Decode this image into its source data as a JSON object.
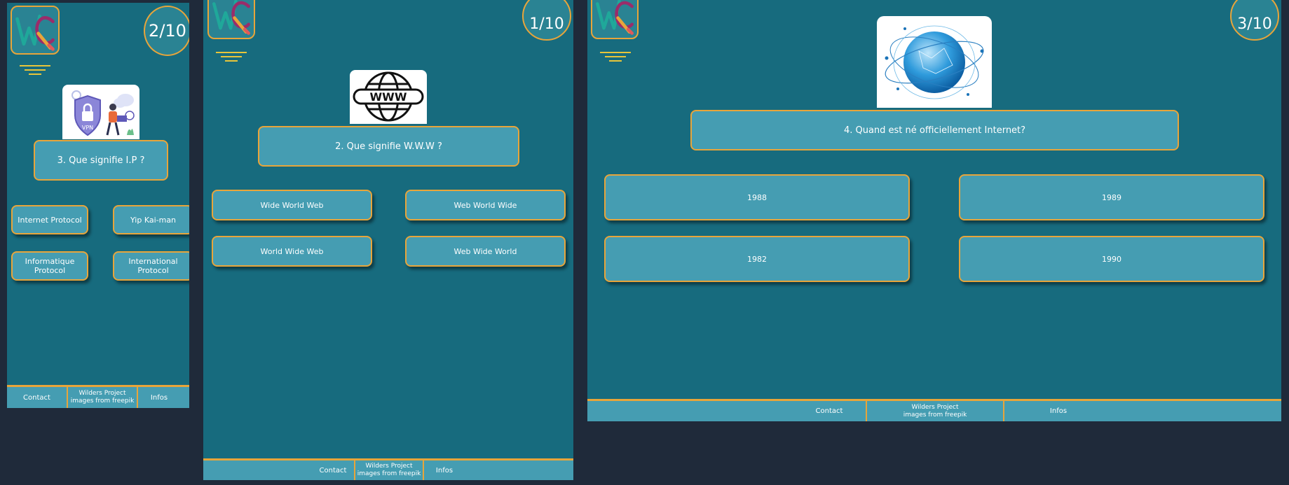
{
  "colors": {
    "page_background": "#1f2a3a",
    "panel_background": "#176b7e",
    "button_fill": "#459db2",
    "accent_border": "#e8a53a"
  },
  "icons": [
    "wc-logo-icon",
    "menu-lines-icon",
    "vpn-illustration",
    "www-globe-icon",
    "earth-network-globe"
  ],
  "panels": [
    {
      "counter": "2/10",
      "question": "3. Que signifie I.P ?",
      "answers": [
        "Internet Protocol",
        "Yip Kai-man",
        "Informatique Protocol",
        "International Protocol"
      ],
      "footer": {
        "contact": "Contact",
        "project_line1": "Wilders Project",
        "project_line2": "images from freepik",
        "infos": "Infos"
      }
    },
    {
      "counter": "1/10",
      "question": "2. Que signifie W.W.W ?",
      "answers": [
        "Wide World Web",
        "Web World Wide",
        "World Wide Web",
        "Web Wide World"
      ],
      "footer": {
        "contact": "Contact",
        "project_line1": "Wilders Project",
        "project_line2": "images from freepik",
        "infos": "Infos"
      }
    },
    {
      "counter": "3/10",
      "question": "4. Quand est né officiellement Internet?",
      "answers": [
        "1988",
        "1989",
        "1982",
        "1990"
      ],
      "footer": {
        "contact": "Contact",
        "project_line1": "Wilders Project",
        "project_line2": "images from freepik",
        "infos": "Infos"
      }
    }
  ]
}
